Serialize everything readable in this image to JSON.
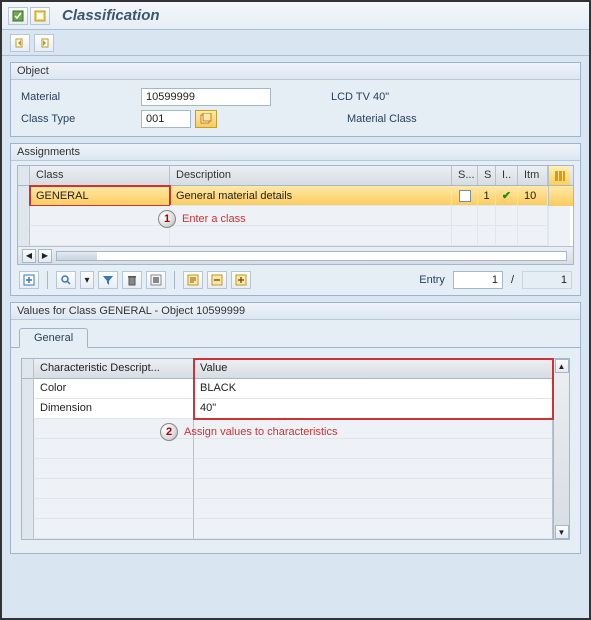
{
  "title": "Classification",
  "object": {
    "panel_title": "Object",
    "material_label": "Material",
    "material_value": "10599999",
    "material_desc": "LCD TV 40\"",
    "classtype_label": "Class Type",
    "classtype_value": "001",
    "classtype_desc": "Material Class"
  },
  "assignments": {
    "panel_title": "Assignments",
    "columns": {
      "class": "Class",
      "description": "Description",
      "s1": "S...",
      "si": "S",
      "i": "I..",
      "itm": "Itm"
    },
    "rows": [
      {
        "class": "GENERAL",
        "description": "General material details",
        "s_checked": false,
        "si": "1",
        "i_status": "released",
        "itm": "10"
      }
    ],
    "callout1": "Enter a class",
    "entry_label": "Entry",
    "entry_current": "1",
    "entry_total": "1"
  },
  "values": {
    "panel_title": "Values for Class GENERAL - Object 10599999",
    "tab_general": "General",
    "columns": {
      "desc": "Characteristic Descript...",
      "value": "Value"
    },
    "rows": [
      {
        "desc": "Color",
        "value": "BLACK"
      },
      {
        "desc": "Dimension",
        "value": "40\""
      }
    ],
    "callout2": "Assign values to characteristics"
  }
}
